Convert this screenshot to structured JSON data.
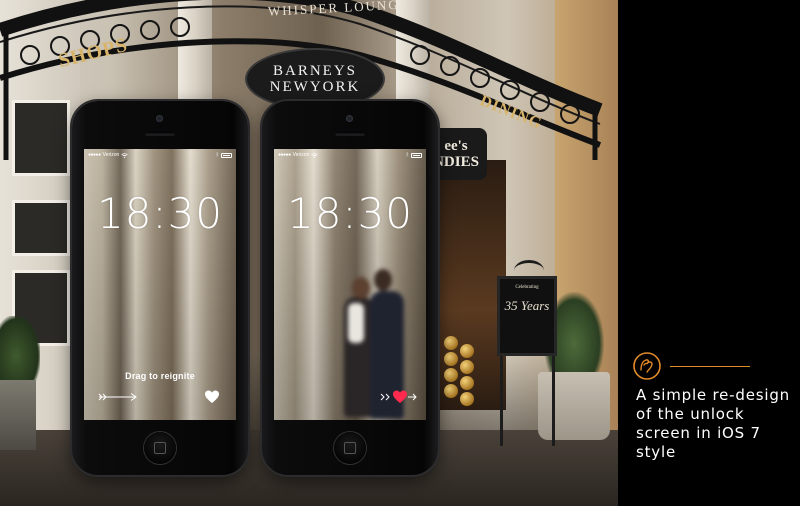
{
  "scene": {
    "arch_left_text": "SHOPS",
    "arch_top_text": "WHISPER LOUNGE",
    "arch_right_text": "DINING",
    "barneys_line1": "BARNEYS",
    "barneys_line2": "NEWYORK",
    "candies_line1": "ee's",
    "candies_line2": "NDIES",
    "easel_small": "Celebrating",
    "easel_big": "35 Years"
  },
  "phones": [
    {
      "carrier": "Verizon",
      "time": "18:30",
      "prompt": "Drag to reignite",
      "heart_style": "outline"
    },
    {
      "carrier": "Verizon",
      "time": "18:30",
      "prompt": "",
      "heart_style": "filled"
    }
  ],
  "panel": {
    "tagline": "A simple re-design of the unlock screen in iOS 7 style"
  },
  "colors": {
    "accent": "#e08a2a",
    "heart_active": "#ff2b4e",
    "panel_bg": "#000000"
  },
  "icons": {
    "logo": "hand-in-circle-icon",
    "wifi": "wifi-icon",
    "battery": "battery-icon",
    "arrow": "arrow-right-icon",
    "heart": "heart-icon"
  }
}
